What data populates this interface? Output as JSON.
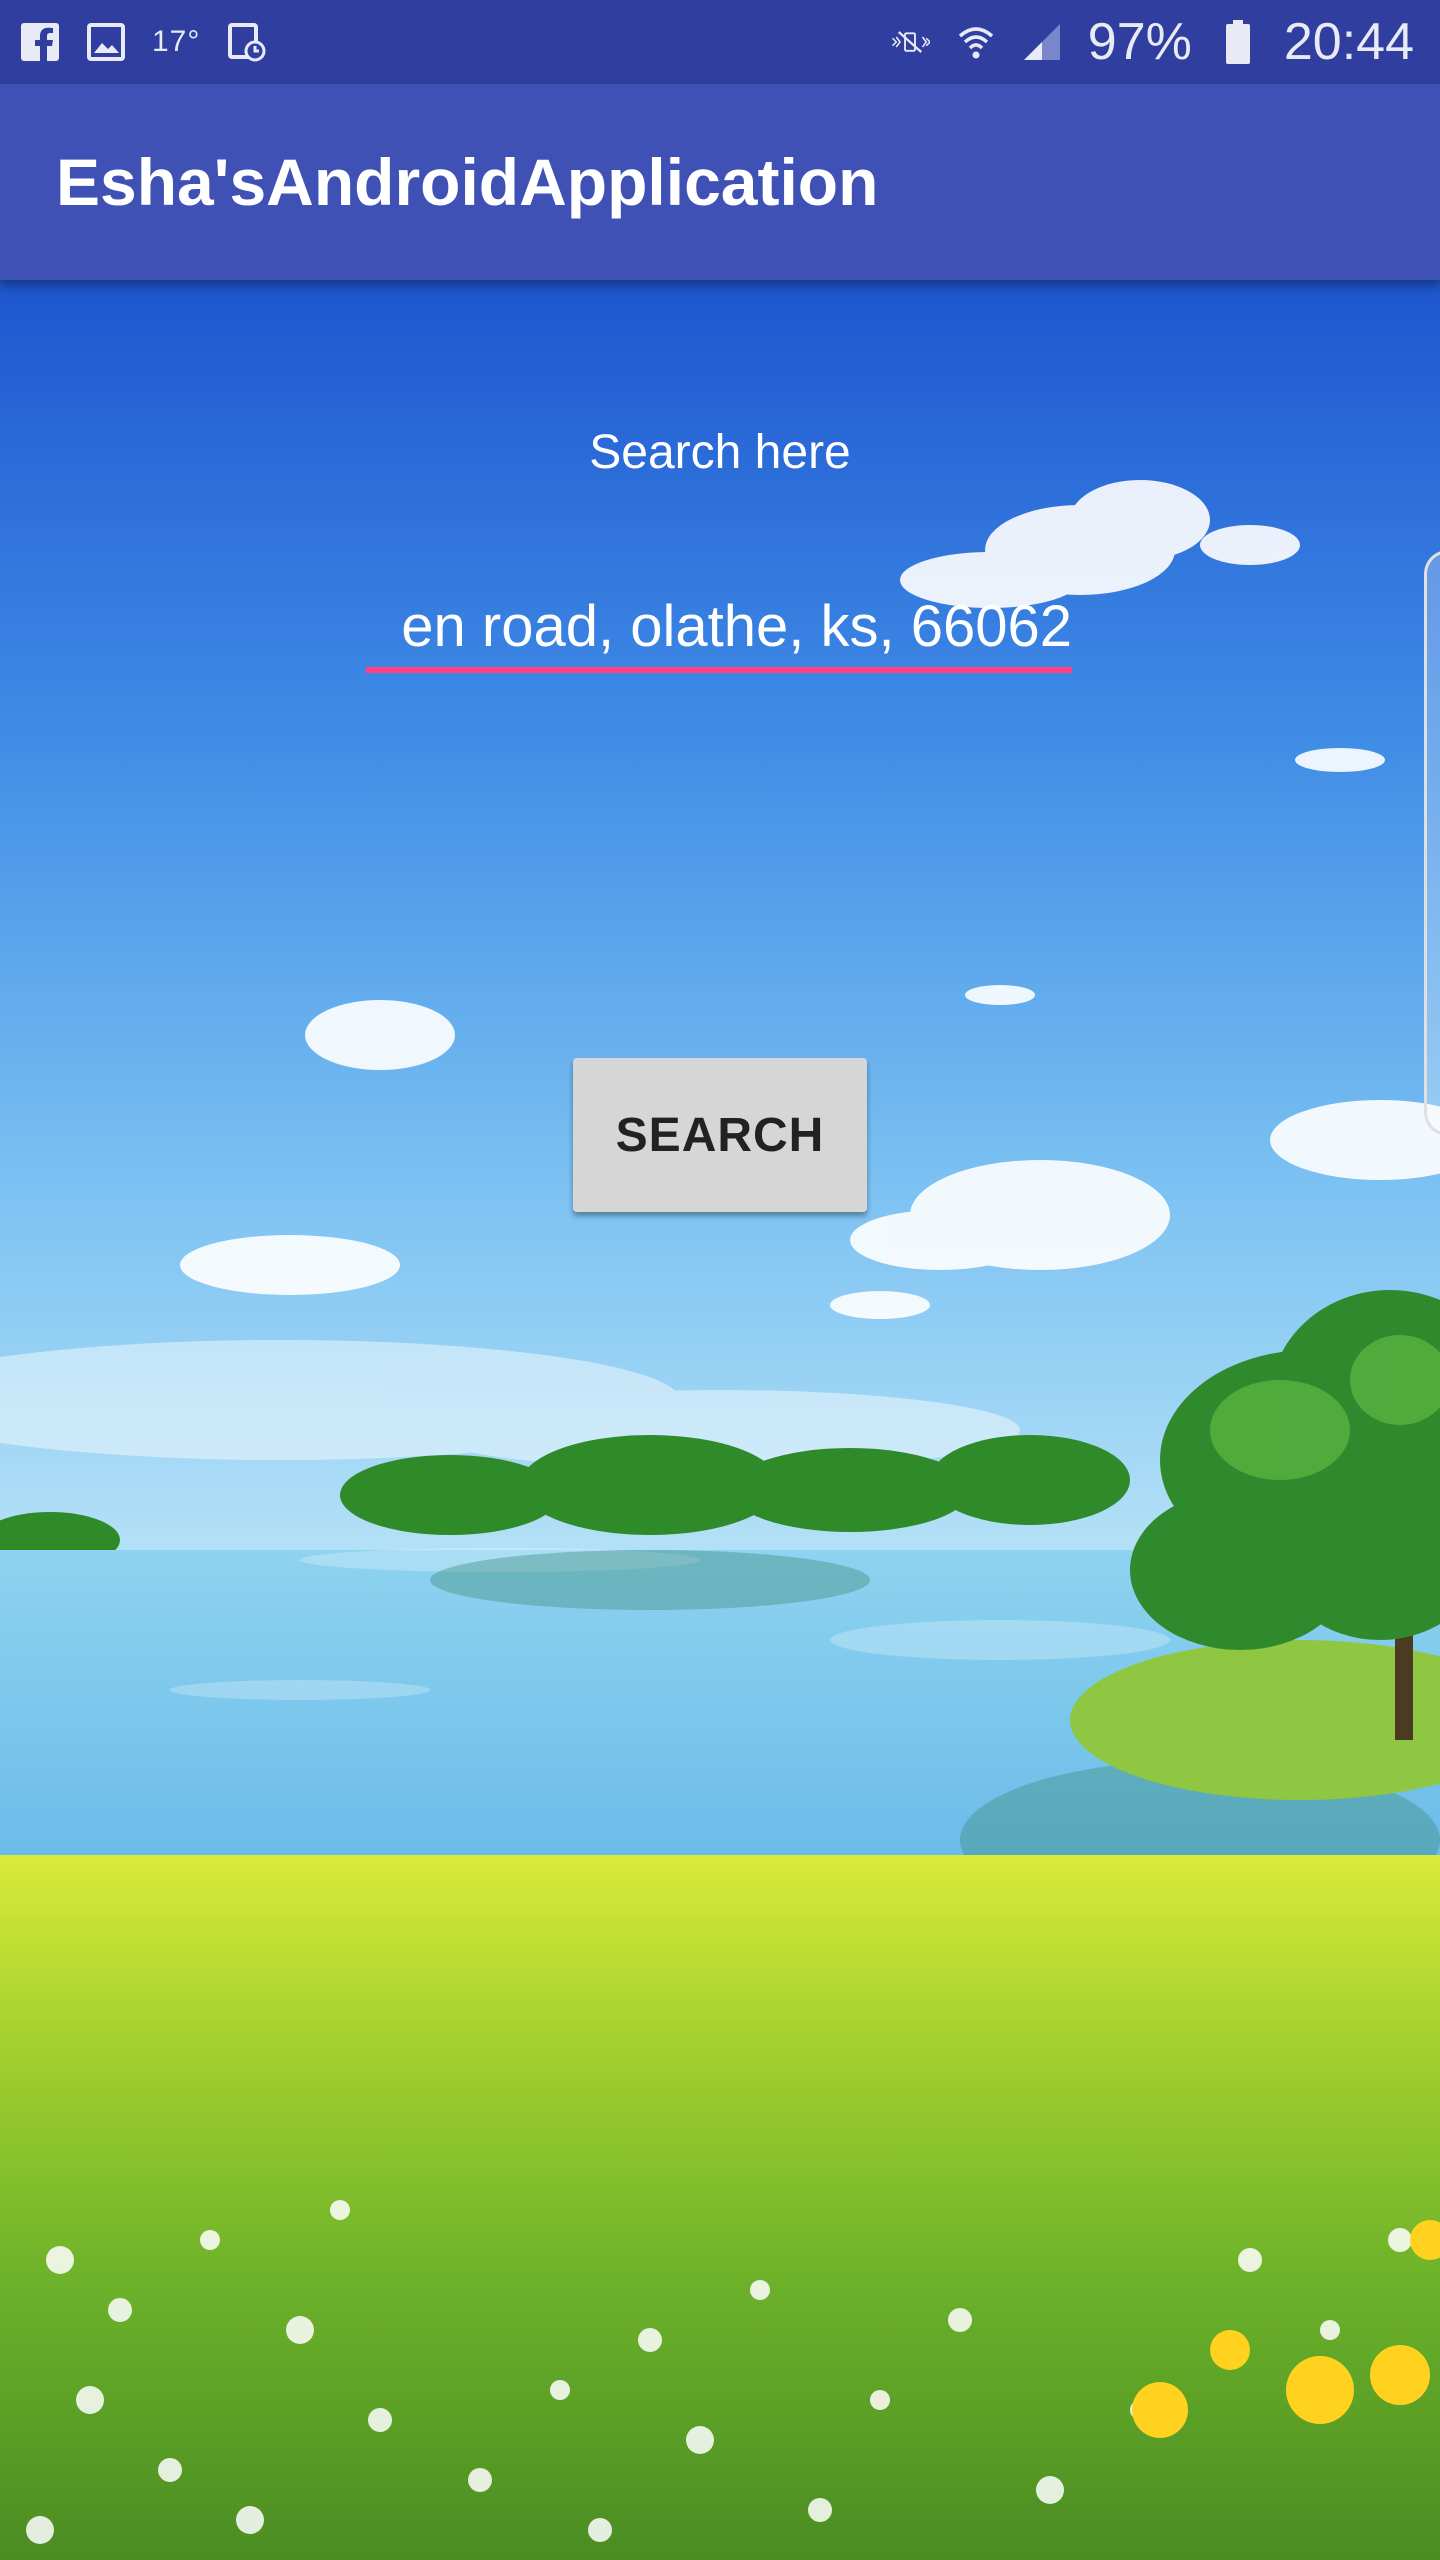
{
  "status_bar": {
    "temperature": "17°",
    "battery": "97%",
    "time": "20:44",
    "icons": [
      "facebook-icon",
      "gallery-icon",
      "temperature-icon",
      "alarm-icon",
      "mute-icon",
      "wifi-icon",
      "signal-icon",
      "battery-icon"
    ]
  },
  "app_bar": {
    "title": "Esha'sAndroidApplication"
  },
  "main": {
    "search_label": "Search here",
    "search_value": "en road, olathe, ks, 66062",
    "search_button": "SEARCH"
  },
  "colors": {
    "status_bar": "#303f9f",
    "app_bar": "#3f51b5",
    "input_underline": "#ff4081",
    "button": "#d6d6d6"
  }
}
